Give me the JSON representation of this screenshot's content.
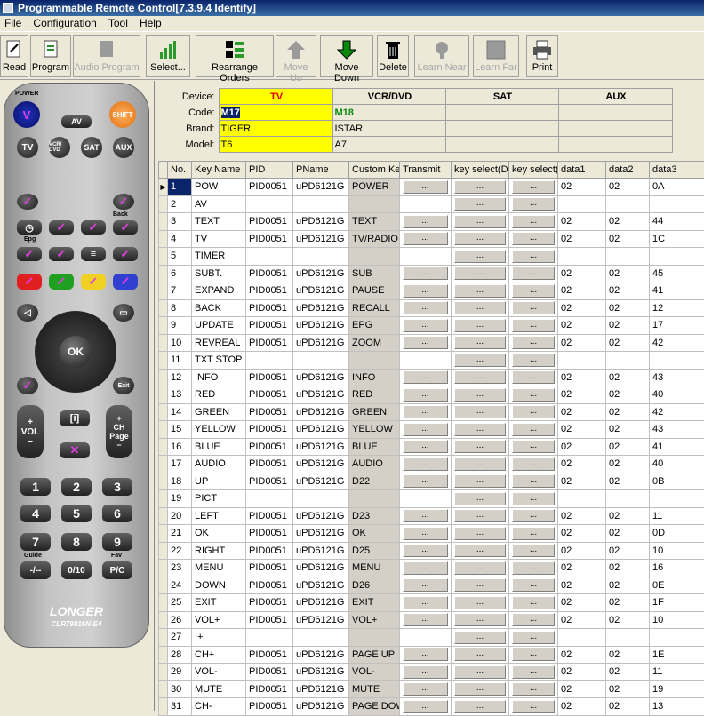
{
  "window": {
    "title": "Programmable Remote Control[7.3.9.4 Identify]"
  },
  "menu": [
    "File",
    "Configuration",
    "Tool",
    "Help"
  ],
  "toolbar": [
    {
      "label": "Read",
      "icon": "read-icon",
      "enabled": true
    },
    {
      "label": "Program",
      "icon": "program-icon",
      "enabled": true
    },
    {
      "label": "Audio Program",
      "icon": "audio-program-icon",
      "enabled": false
    },
    {
      "label": "Select...",
      "icon": "select-chart-icon",
      "enabled": true
    },
    {
      "label": "Rearrange Orders",
      "icon": "rearrange-icon",
      "enabled": true
    },
    {
      "label": "Move Up",
      "icon": "move-up-icon",
      "enabled": false
    },
    {
      "label": "Move Down",
      "icon": "move-down-icon",
      "enabled": true
    },
    {
      "label": "Delete",
      "icon": "delete-icon",
      "enabled": true
    },
    {
      "label": "Learn Near",
      "icon": "learn-near-icon",
      "enabled": false
    },
    {
      "label": "Learn Far",
      "icon": "learn-far-icon",
      "enabled": false
    },
    {
      "label": "Print",
      "icon": "print-icon",
      "enabled": true
    }
  ],
  "remote": {
    "power_label": "POWER",
    "av": "AV",
    "shift": "SHIFT",
    "tv": "TV",
    "vcr": "VCR/ DVD",
    "sat": "SAT",
    "aux": "AUX",
    "back": "Back",
    "epg": "Epg",
    "ok": "OK",
    "exit": "Exit",
    "vol": "VOL",
    "ch": "CH Page",
    "digits": [
      "1",
      "2",
      "3",
      "4",
      "5",
      "6",
      "7",
      "8",
      "9"
    ],
    "guide": "Guide",
    "fav": "Fav",
    "zero": "0/10",
    "dash": "-/--",
    "pc": "P/C",
    "brand": "LONGER",
    "model": "CLR79816N-E4"
  },
  "device_panel": {
    "labels": {
      "device": "Device:",
      "code": "Code:",
      "brand": "Brand:",
      "model": "Model:"
    },
    "devices": [
      {
        "name": "TV",
        "code": "M17",
        "brand": "TIGER",
        "model": "T6"
      },
      {
        "name": "VCR/DVD",
        "code": "M18",
        "brand": "ISTAR",
        "model": "A7"
      },
      {
        "name": "SAT",
        "code": "",
        "brand": "",
        "model": ""
      },
      {
        "name": "AUX",
        "code": "",
        "brand": "",
        "model": ""
      }
    ]
  },
  "columns": [
    "No.",
    "Key Name",
    "PID",
    "PName",
    "Custom Key",
    "Transmit",
    "key select(Da",
    "key select(I",
    "data1",
    "data2",
    "data3"
  ],
  "button_text": "...",
  "rows": [
    {
      "no": "1",
      "key": "POW",
      "pid": "PID0051",
      "pname": "uPD6121G",
      "custom": "POWER",
      "d1": "02",
      "d2": "02",
      "d3": "0A"
    },
    {
      "no": "2",
      "key": "AV",
      "pid": "",
      "pname": "",
      "custom": "",
      "d1": "",
      "d2": "",
      "d3": ""
    },
    {
      "no": "3",
      "key": "TEXT",
      "pid": "PID0051",
      "pname": "uPD6121G",
      "custom": "TEXT",
      "d1": "02",
      "d2": "02",
      "d3": "44"
    },
    {
      "no": "4",
      "key": "TV",
      "pid": "PID0051",
      "pname": "uPD6121G",
      "custom": "TV/RADIO",
      "d1": "02",
      "d2": "02",
      "d3": "1C"
    },
    {
      "no": "5",
      "key": "TIMER",
      "pid": "",
      "pname": "",
      "custom": "",
      "d1": "",
      "d2": "",
      "d3": ""
    },
    {
      "no": "6",
      "key": "SUBT.",
      "pid": "PID0051",
      "pname": "uPD6121G",
      "custom": "SUB",
      "d1": "02",
      "d2": "02",
      "d3": "45"
    },
    {
      "no": "7",
      "key": "EXPAND",
      "pid": "PID0051",
      "pname": "uPD6121G",
      "custom": "PAUSE",
      "d1": "02",
      "d2": "02",
      "d3": "41"
    },
    {
      "no": "8",
      "key": "BACK",
      "pid": "PID0051",
      "pname": "uPD6121G",
      "custom": "RECALL",
      "d1": "02",
      "d2": "02",
      "d3": "12"
    },
    {
      "no": "9",
      "key": "UPDATE",
      "pid": "PID0051",
      "pname": "uPD6121G",
      "custom": "EPG",
      "d1": "02",
      "d2": "02",
      "d3": "17"
    },
    {
      "no": "10",
      "key": "REVREAL",
      "pid": "PID0051",
      "pname": "uPD6121G",
      "custom": "ZOOM",
      "d1": "02",
      "d2": "02",
      "d3": "42"
    },
    {
      "no": "11",
      "key": "TXT STOP",
      "pid": "",
      "pname": "",
      "custom": "",
      "d1": "",
      "d2": "",
      "d3": ""
    },
    {
      "no": "12",
      "key": "INFO",
      "pid": "PID0051",
      "pname": "uPD6121G",
      "custom": "INFO",
      "d1": "02",
      "d2": "02",
      "d3": "43"
    },
    {
      "no": "13",
      "key": "RED",
      "pid": "PID0051",
      "pname": "uPD6121G",
      "custom": "RED",
      "d1": "02",
      "d2": "02",
      "d3": "40"
    },
    {
      "no": "14",
      "key": "GREEN",
      "pid": "PID0051",
      "pname": "uPD6121G",
      "custom": "GREEN",
      "d1": "02",
      "d2": "02",
      "d3": "42"
    },
    {
      "no": "15",
      "key": "YELLOW",
      "pid": "PID0051",
      "pname": "uPD6121G",
      "custom": "YELLOW",
      "d1": "02",
      "d2": "02",
      "d3": "43"
    },
    {
      "no": "16",
      "key": "BLUE",
      "pid": "PID0051",
      "pname": "uPD6121G",
      "custom": "BLUE",
      "d1": "02",
      "d2": "02",
      "d3": "41"
    },
    {
      "no": "17",
      "key": "AUDIO",
      "pid": "PID0051",
      "pname": "uPD6121G",
      "custom": "AUDIO",
      "d1": "02",
      "d2": "02",
      "d3": "40"
    },
    {
      "no": "18",
      "key": "UP",
      "pid": "PID0051",
      "pname": "uPD6121G",
      "custom": "D22",
      "d1": "02",
      "d2": "02",
      "d3": "0B"
    },
    {
      "no": "19",
      "key": "PICT",
      "pid": "",
      "pname": "",
      "custom": "",
      "d1": "",
      "d2": "",
      "d3": ""
    },
    {
      "no": "20",
      "key": "LEFT",
      "pid": "PID0051",
      "pname": "uPD6121G",
      "custom": "D23",
      "d1": "02",
      "d2": "02",
      "d3": "11"
    },
    {
      "no": "21",
      "key": "OK",
      "pid": "PID0051",
      "pname": "uPD6121G",
      "custom": "OK",
      "d1": "02",
      "d2": "02",
      "d3": "0D"
    },
    {
      "no": "22",
      "key": "RIGHT",
      "pid": "PID0051",
      "pname": "uPD6121G",
      "custom": "D25",
      "d1": "02",
      "d2": "02",
      "d3": "10"
    },
    {
      "no": "23",
      "key": "MENU",
      "pid": "PID0051",
      "pname": "uPD6121G",
      "custom": "MENU",
      "d1": "02",
      "d2": "02",
      "d3": "16"
    },
    {
      "no": "24",
      "key": "DOWN",
      "pid": "PID0051",
      "pname": "uPD6121G",
      "custom": "D26",
      "d1": "02",
      "d2": "02",
      "d3": "0E"
    },
    {
      "no": "25",
      "key": "EXIT",
      "pid": "PID0051",
      "pname": "uPD6121G",
      "custom": "EXIT",
      "d1": "02",
      "d2": "02",
      "d3": "1F"
    },
    {
      "no": "26",
      "key": "VOL+",
      "pid": "PID0051",
      "pname": "uPD6121G",
      "custom": "VOL+",
      "d1": "02",
      "d2": "02",
      "d3": "10"
    },
    {
      "no": "27",
      "key": "I+",
      "pid": "",
      "pname": "",
      "custom": "",
      "d1": "",
      "d2": "",
      "d3": ""
    },
    {
      "no": "28",
      "key": "CH+",
      "pid": "PID0051",
      "pname": "uPD6121G",
      "custom": "PAGE UP",
      "d1": "02",
      "d2": "02",
      "d3": "1E"
    },
    {
      "no": "29",
      "key": "VOL-",
      "pid": "PID0051",
      "pname": "uPD6121G",
      "custom": "VOL-",
      "d1": "02",
      "d2": "02",
      "d3": "11"
    },
    {
      "no": "30",
      "key": "MUTE",
      "pid": "PID0051",
      "pname": "uPD6121G",
      "custom": "MUTE",
      "d1": "02",
      "d2": "02",
      "d3": "19"
    },
    {
      "no": "31",
      "key": "CH-",
      "pid": "PID0051",
      "pname": "uPD6121G",
      "custom": "PAGE DOW",
      "d1": "02",
      "d2": "02",
      "d3": "13"
    }
  ]
}
